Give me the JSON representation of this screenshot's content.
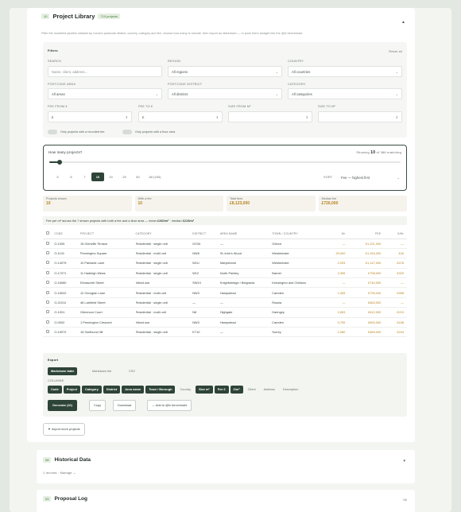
{
  "project_library": {
    "badge_left": "10",
    "title": "Project Library",
    "badge_count": "710 projects",
    "description": "Filter the modelled pipeline dataset by London postcode district, country, category and fee, choose how many to include, then export as Markdown — or push them straight into the @fc benchmark."
  },
  "filters": {
    "title": "Filters",
    "reset": "Reset all",
    "search_label": "SEARCH",
    "search_placeholder": "Name, client, address...",
    "region_label": "REGION",
    "region_value": "All regions",
    "country_label": "COUNTRY",
    "country_value": "All countries",
    "postcode_area_label": "POSTCODE AREA",
    "postcode_area_value": "All areas",
    "postcode_district_label": "POSTCODE DISTRICT",
    "postcode_district_value": "All districts",
    "category_label": "CATEGORY",
    "category_value": "All categories",
    "fee_from_label": "FEE FROM £",
    "fee_from_value": "£",
    "fee_to_label": "FEE TO £",
    "fee_to_value": "£",
    "size_from_label": "SIZE FROM M²",
    "size_to_label": "SIZE TO M²",
    "toggle_fee": "Only projects with a recorded fee",
    "toggle_area": "Only projects with a floor area"
  },
  "howmany": {
    "title": "How many projects?",
    "showing_prefix": "Showing",
    "showing_count": "10",
    "showing_suffix": "of 386 matching",
    "steps": [
      "5",
      "8",
      "7",
      "10",
      "15",
      "25",
      "50",
      "All (150)"
    ],
    "active_step": "10",
    "sort_label": "SORT",
    "sort_value": "Fee — highest first",
    "slider_fraction": 0.03
  },
  "stats": [
    {
      "label": "Projects shown",
      "value": "10"
    },
    {
      "label": "With a fee",
      "value": "10"
    },
    {
      "label": "Total fees",
      "value": "£8,123,000"
    },
    {
      "label": "Median fee",
      "value": "£726,000"
    }
  ],
  "insight": {
    "text": "Fee per m² across the 7 shown projects with both a fee and a floor area — mean ",
    "mean": "£260/m²",
    "median_prefix": " · median ",
    "median": "£219/m²"
  },
  "table": {
    "headers": [
      "CODE",
      "PROJECT",
      "CATEGORY",
      "DISTRICT",
      "AREA NAME",
      "TOWN / COUNTRY",
      "M²",
      "FEE",
      "£/M²"
    ],
    "rows": [
      [
        "O-1005",
        "15 Glenville Terrace",
        "Residential · single unit",
        "OX34",
        "—",
        "Oxford",
        "—",
        "£1,221,000",
        "—"
      ],
      [
        "O-1131",
        "Pennington Square",
        "Residential · multi unit",
        "NW8",
        "St John's Wood",
        "Westminster",
        "20,000",
        "£1,150,000",
        "£40"
      ],
      [
        "O-14079",
        "10 Parkside Lane",
        "Residential · single unit",
        "W1U",
        "Marylebone",
        "Westminster",
        "2,093",
        "£1,147,000",
        "£478"
      ],
      [
        "O-17071",
        "11 Hadleigh Mews",
        "Residential · single unit",
        "W12",
        "North Parkley",
        "Barnet",
        "2,395",
        "£798,000",
        "£329"
      ],
      [
        "O-16060",
        "Elmsworth Street",
        "Mixed use",
        "SW1X",
        "Knightsbridge / Belgravia",
        "Kensington and Chelsea",
        "—",
        "£740,000",
        "—"
      ],
      [
        "O-15022",
        "12 Georgian Lane",
        "Residential · multi unit",
        "NW3",
        "Hampstead",
        "Camden",
        "1,405",
        "£735,000",
        "£358"
      ],
      [
        "O-21011",
        "46 Larkfield Street",
        "Residential · single unit",
        "—",
        "—",
        "Russia",
        "—",
        "£663,000",
        "—"
      ],
      [
        "O-1001",
        "Glenmoor Court",
        "Residential · multi unit",
        "N8",
        "Highgate",
        "Haringey",
        "2,803",
        "£612,000",
        "£219"
      ],
      [
        "O-0002",
        "1 Pennington Crescent",
        "Mixed use",
        "NW3",
        "Hampstead",
        "Camden",
        "3,799",
        "£600,000",
        "£158"
      ],
      [
        "O-19072",
        "15 Smithund Hill",
        "Residential · single unit",
        "KT10",
        "—",
        "Surrey",
        "2,060",
        "£489,000",
        "£244"
      ]
    ]
  },
  "export": {
    "title": "Export",
    "formats": [
      "Markdown table",
      "Markdown list",
      "CSV"
    ],
    "columns_label": "COLUMNS",
    "columns_on": [
      "Code",
      "Project",
      "Category",
      "District",
      "Area name",
      "Town / Borough"
    ],
    "columns_off_1": "Country",
    "columns_on_2": [
      "Size m²",
      "Fee £",
      "£/m²"
    ],
    "columns_off_2": [
      "Client",
      "Address",
      "Description"
    ],
    "generate": "Generate (10)",
    "copy": "Copy",
    "download": "Download",
    "add_benchmark": "→ Add to @fc benchmark"
  },
  "import_button": "▼ Import more projects",
  "historical": {
    "badge": "08",
    "title": "Historical Data",
    "sub": "1 records · Manage →"
  },
  "proposal": {
    "badge": "09",
    "title": "Proposal Log",
    "badge_right": "96"
  }
}
